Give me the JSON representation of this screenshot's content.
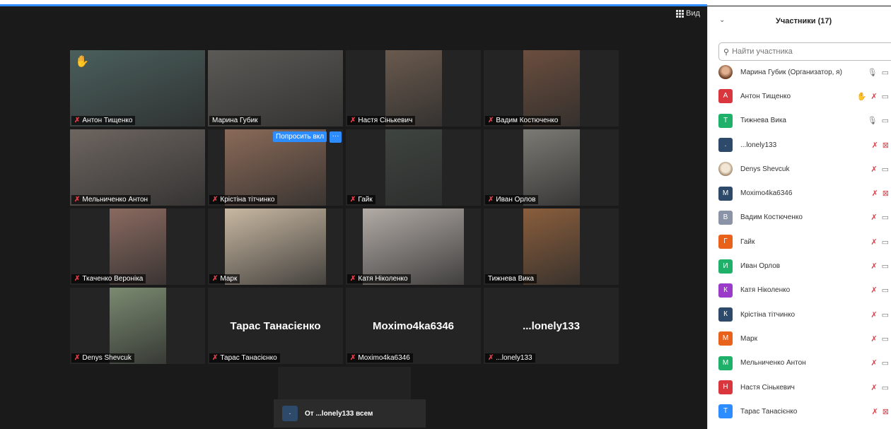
{
  "window": {
    "view_label": "Вид"
  },
  "grid": {
    "tiles": [
      {
        "name": "Антон Тищенко",
        "mic": "off",
        "video": true,
        "hand": true,
        "video_color": "#4a5f5c",
        "video_w": 191
      },
      {
        "name": "Марина Губик",
        "mic": "on",
        "video": true,
        "active": true,
        "video_color": "#5c5a56",
        "video_w": 191
      },
      {
        "name": "Настя Сінькевич",
        "mic": "off",
        "video": true,
        "video_color": "#6a5a4e",
        "video_w": 80
      },
      {
        "name": "Вадим Костюченко",
        "mic": "off",
        "video": true,
        "video_color": "#6b4e3e",
        "video_w": 80
      },
      {
        "name": "Мельниченко Антон",
        "mic": "off",
        "video": true,
        "video_color": "#6d6560",
        "video_w": 191
      },
      {
        "name": "Крістіна тітчинко",
        "mic": "off",
        "video": true,
        "ask_label": "Попросить вкл",
        "video_color": "#8a6a58",
        "video_w": 143
      },
      {
        "name": "Гайк",
        "mic": "off",
        "video": true,
        "video_color": "#3e4440",
        "video_w": 80
      },
      {
        "name": "Иван Орлов",
        "mic": "off",
        "video": true,
        "video_color": "#7c7a74",
        "video_w": 80
      },
      {
        "name": "Ткаченко Вероніка",
        "mic": "off",
        "video": true,
        "video_color": "#8a6a60",
        "video_w": 80
      },
      {
        "name": "Марк",
        "mic": "off",
        "video": true,
        "video_color": "#c8b8a2",
        "video_w": 143
      },
      {
        "name": "Катя Ніколенко",
        "mic": "off",
        "video": true,
        "video_color": "#b2aba6",
        "video_w": 143
      },
      {
        "name": "Тижнева Вика",
        "mic": "on",
        "video": true,
        "video_color": "#8a5e3c",
        "video_w": 80
      },
      {
        "name": "Denys Shevcuk",
        "mic": "off",
        "video": true,
        "video_color": "#7a8a70",
        "video_w": 80
      },
      {
        "name": "Тарас Танасієнко",
        "mic": "off",
        "video": false,
        "big_name": "Тарас Танасієнко"
      },
      {
        "name": "Moximo4ka6346",
        "mic": "off",
        "video": false,
        "big_name": "Moximo4ka6346"
      },
      {
        "name": "...lonely133",
        "mic": "off",
        "video": false,
        "big_name": "...lonely133"
      }
    ]
  },
  "chat_toast": {
    "avatar_letter": ".",
    "text": "От ...lonely133 всем"
  },
  "panel": {
    "title": "Участники (17)",
    "search_placeholder": "Найти участника",
    "participants": [
      {
        "name": "Марина Губик (Организатор, я)",
        "avatar": "photo",
        "color": "",
        "letter": "",
        "mic": "on",
        "cam": "on"
      },
      {
        "name": "Антон Тищенко",
        "avatar": "letter",
        "color": "#d9363e",
        "letter": "А",
        "mic": "off",
        "cam": "on",
        "hand": true
      },
      {
        "name": "Тижнева Вика",
        "avatar": "letter",
        "color": "#1fb16a",
        "letter": "Т",
        "mic": "on",
        "cam": "on"
      },
      {
        "name": "...lonely133",
        "avatar": "letter",
        "color": "#2d4a6a",
        "letter": ".",
        "mic": "off",
        "cam": "off"
      },
      {
        "name": "Denys Shevcuk",
        "avatar": "dog",
        "color": "",
        "letter": "",
        "mic": "off",
        "cam": "on"
      },
      {
        "name": "Moximo4ka6346",
        "avatar": "letter",
        "color": "#2d4a6a",
        "letter": "M",
        "mic": "off",
        "cam": "off"
      },
      {
        "name": "Вадим Костюченко",
        "avatar": "letter",
        "color": "#8a94a6",
        "letter": "В",
        "mic": "off",
        "cam": "on"
      },
      {
        "name": "Гайк",
        "avatar": "letter",
        "color": "#e8621c",
        "letter": "Г",
        "mic": "off",
        "cam": "on"
      },
      {
        "name": "Иван Орлов",
        "avatar": "letter",
        "color": "#1fb16a",
        "letter": "И",
        "mic": "off",
        "cam": "on"
      },
      {
        "name": "Катя Ніколенко",
        "avatar": "letter",
        "color": "#9b3bc9",
        "letter": "К",
        "mic": "off",
        "cam": "on"
      },
      {
        "name": "Крістіна тітчинко",
        "avatar": "letter",
        "color": "#2d4a6a",
        "letter": "К",
        "mic": "off",
        "cam": "on"
      },
      {
        "name": "Марк",
        "avatar": "letter",
        "color": "#e8621c",
        "letter": "М",
        "mic": "off",
        "cam": "on"
      },
      {
        "name": "Мельниченко Антон",
        "avatar": "letter",
        "color": "#1fb16a",
        "letter": "М",
        "mic": "off",
        "cam": "on"
      },
      {
        "name": "Настя Сінькевич",
        "avatar": "letter",
        "color": "#d9363e",
        "letter": "Н",
        "mic": "off",
        "cam": "on"
      },
      {
        "name": "Тарас Танасієнко",
        "avatar": "letter",
        "color": "#2d8cff",
        "letter": "Т",
        "mic": "off",
        "cam": "off"
      }
    ]
  },
  "icons": {
    "mic_off": "✗",
    "mic_on": "🎙",
    "cam": "▭",
    "cam_off": "⊠",
    "hand": "✋",
    "more": "···",
    "chevron": "⌄",
    "search": "⚲"
  }
}
